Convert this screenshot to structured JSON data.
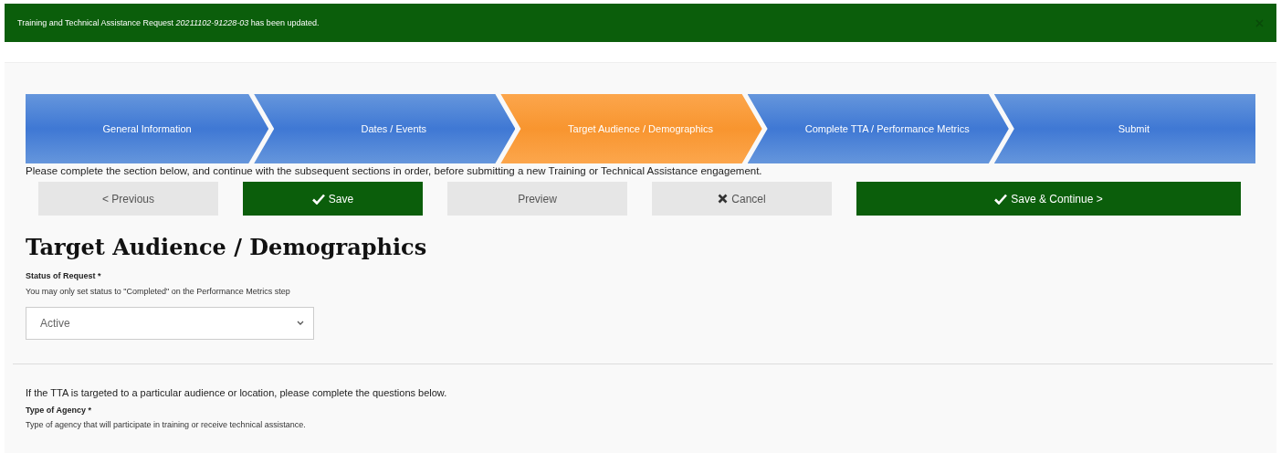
{
  "banner": {
    "message": "Training and Technical Assistance Request *20211102-91228-03* has been updated."
  },
  "steps": [
    {
      "label": "General Information",
      "selected": false
    },
    {
      "label": "Dates / Events",
      "selected": false
    },
    {
      "label": "Target Audience / Demographics",
      "selected": true
    },
    {
      "label": "Complete TTA / Performance Metrics",
      "selected": false
    },
    {
      "label": "Submit",
      "selected": false
    }
  ],
  "instructions": "Please complete the section below, and continue with the subsequent sections in order, before submitting a new Training or Technical Assistance engagement.",
  "buttons": [
    {
      "label": "< Previous",
      "kind": "plain"
    },
    {
      "label": "Save",
      "kind": "primary"
    },
    {
      "label": "Preview",
      "kind": "plain"
    },
    {
      "label": "Cancel",
      "kind": "cancel"
    },
    {
      "label": "Save & Continue >",
      "kind": "primary-wide"
    }
  ],
  "heading": "Target Audience / Demographics",
  "status_field": {
    "label": "Status of Request",
    "required_mark": "*",
    "help": "You may only set status to \"Completed\" on the Performance Metrics step",
    "value": "Active"
  },
  "intro": "If the TTA is targeted to a particular audience or location, please complete the questions below.",
  "agency_field": {
    "label": "Type of Agency",
    "required_mark": "*",
    "help": "Type of agency that will participate in training or receive technical assistance."
  }
}
